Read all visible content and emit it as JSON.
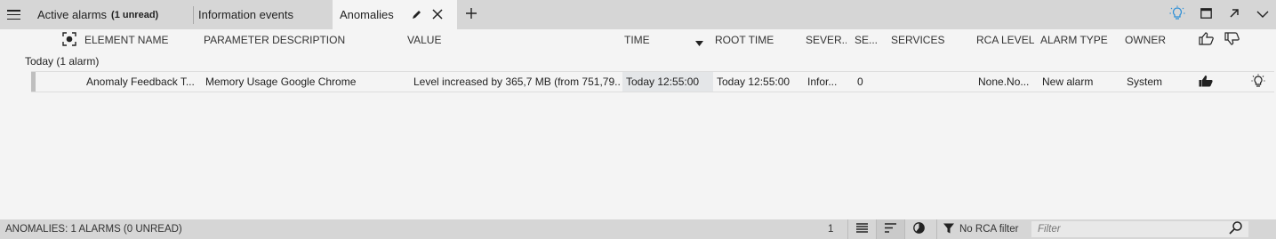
{
  "tabs": {
    "active_alarms": {
      "label": "Active alarms",
      "unread": "(1 unread)"
    },
    "information_events": {
      "label": "Information events"
    },
    "anomalies": {
      "label": "Anomalies"
    }
  },
  "columns": {
    "element_name": "ELEMENT NAME",
    "parameter_description": "PARAMETER DESCRIPTION",
    "value": "VALUE",
    "time": "TIME",
    "root_time": "ROOT TIME",
    "severity": "SEVER...",
    "se": "SE...",
    "services": "SERVICES",
    "rca_level": "RCA LEVEL",
    "alarm_type": "ALARM TYPE",
    "owner": "OWNER"
  },
  "group": {
    "label": "Today (1 alarm)"
  },
  "rows": [
    {
      "element_name": "Anomaly Feedback T...",
      "parameter_description": "Memory Usage Google Chrome",
      "value": "Level increased by 365,7 MB (from 751,79...",
      "time": "Today 12:55:00",
      "root_time": "Today 12:55:00",
      "severity": "Infor...",
      "se": "0",
      "services": "",
      "rca_level": "None.No...",
      "alarm_type": "New alarm",
      "owner": "System"
    }
  ],
  "statusbar": {
    "summary": "ANOMALIES: 1 ALARMS (0 UNREAD)",
    "count": "1",
    "rca_filter": "No RCA filter",
    "filter_placeholder": "Filter"
  },
  "colors": {
    "tabbar_bg": "#d6d6d6",
    "body_bg": "#f4f4f4",
    "accent_blue": "#2e8fd6"
  }
}
